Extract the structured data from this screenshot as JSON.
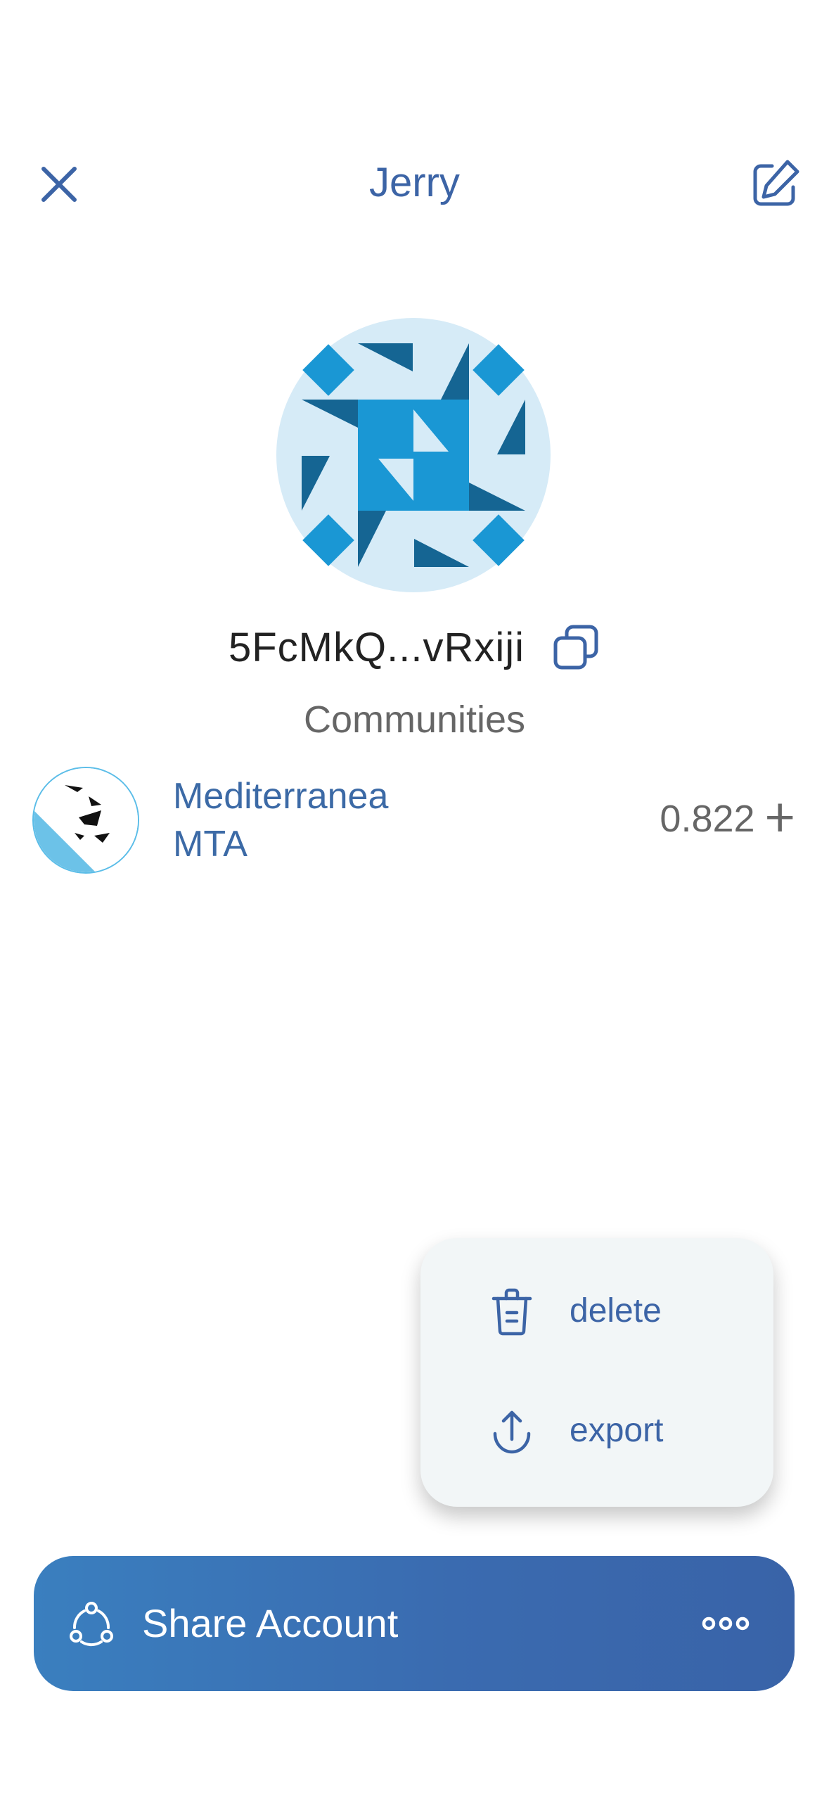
{
  "header": {
    "title": "Jerry",
    "close_icon": "close-icon",
    "edit_icon": "edit-icon"
  },
  "account": {
    "address": "5FcMkQ...vRxiji",
    "copy_icon": "copy-icon"
  },
  "communities": {
    "section_label": "Communities",
    "items": [
      {
        "name": "Mediterranea",
        "symbol": "MTA",
        "balance": "0.822 ⵜ"
      }
    ]
  },
  "menu": {
    "items": [
      {
        "label": "delete",
        "icon": "trash-icon"
      },
      {
        "label": "export",
        "icon": "upload-icon"
      }
    ]
  },
  "share_bar": {
    "label": "Share Account",
    "share_icon": "share-icon",
    "more_icon": "more-icon"
  },
  "colors": {
    "accent": "#3c64a6",
    "identicon_bg": "#d6ebf7",
    "identicon_mid": "#1a97d4",
    "identicon_dark": "#156593"
  }
}
